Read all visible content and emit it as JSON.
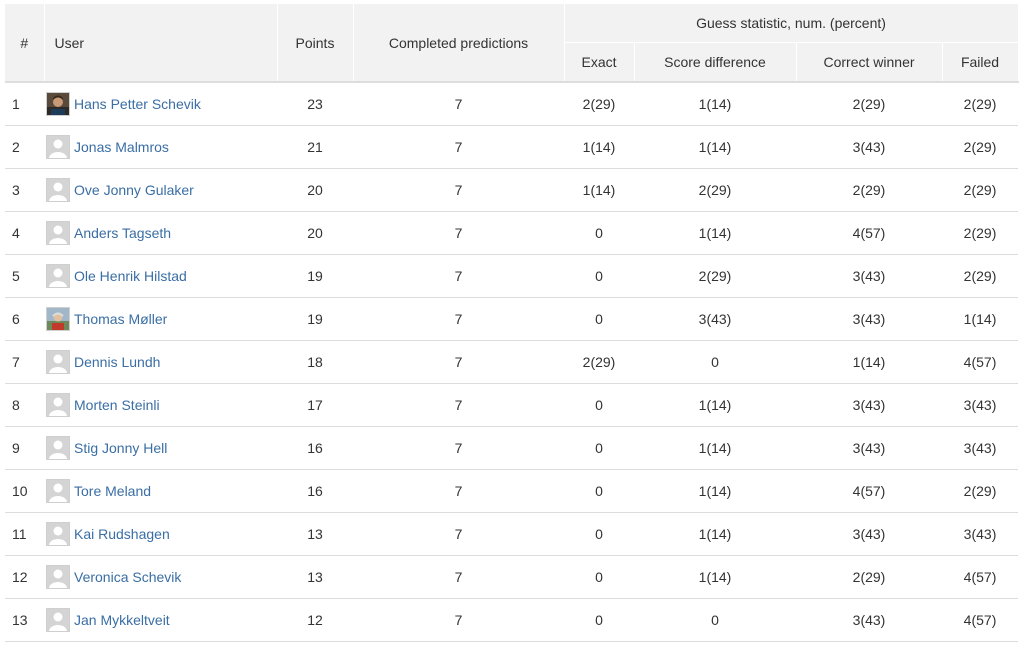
{
  "headers": {
    "rank": "#",
    "user": "User",
    "points": "Points",
    "completed": "Completed predictions",
    "group": "Guess statistic, num. (percent)",
    "exact": "Exact",
    "score_diff": "Score difference",
    "correct_winner": "Correct winner",
    "failed": "Failed"
  },
  "rows": [
    {
      "rank": "1",
      "name": "Hans Petter Schevik",
      "avatar": "photo-avatar-icon",
      "points": "23",
      "completed": "7",
      "exact": "2(29)",
      "score_diff": "1(14)",
      "correct_winner": "2(29)",
      "failed": "2(29)"
    },
    {
      "rank": "2",
      "name": "Jonas Malmros",
      "avatar": "default-avatar-icon",
      "points": "21",
      "completed": "7",
      "exact": "1(14)",
      "score_diff": "1(14)",
      "correct_winner": "3(43)",
      "failed": "2(29)"
    },
    {
      "rank": "3",
      "name": "Ove Jonny Gulaker",
      "avatar": "default-avatar-icon",
      "points": "20",
      "completed": "7",
      "exact": "1(14)",
      "score_diff": "2(29)",
      "correct_winner": "2(29)",
      "failed": "2(29)"
    },
    {
      "rank": "4",
      "name": "Anders Tagseth",
      "avatar": "default-avatar-icon",
      "points": "20",
      "completed": "7",
      "exact": "0",
      "score_diff": "1(14)",
      "correct_winner": "4(57)",
      "failed": "2(29)"
    },
    {
      "rank": "5",
      "name": "Ole Henrik Hilstad",
      "avatar": "default-avatar-icon",
      "points": "19",
      "completed": "7",
      "exact": "0",
      "score_diff": "2(29)",
      "correct_winner": "3(43)",
      "failed": "2(29)"
    },
    {
      "rank": "6",
      "name": "Thomas Møller",
      "avatar": "photo-avatar-icon",
      "points": "19",
      "completed": "7",
      "exact": "0",
      "score_diff": "3(43)",
      "correct_winner": "3(43)",
      "failed": "1(14)"
    },
    {
      "rank": "7",
      "name": "Dennis Lundh",
      "avatar": "default-avatar-icon",
      "points": "18",
      "completed": "7",
      "exact": "2(29)",
      "score_diff": "0",
      "correct_winner": "1(14)",
      "failed": "4(57)"
    },
    {
      "rank": "8",
      "name": "Morten Steinli",
      "avatar": "default-avatar-icon",
      "points": "17",
      "completed": "7",
      "exact": "0",
      "score_diff": "1(14)",
      "correct_winner": "3(43)",
      "failed": "3(43)"
    },
    {
      "rank": "9",
      "name": "Stig Jonny Hell",
      "avatar": "default-avatar-icon",
      "points": "16",
      "completed": "7",
      "exact": "0",
      "score_diff": "1(14)",
      "correct_winner": "3(43)",
      "failed": "3(43)"
    },
    {
      "rank": "10",
      "name": "Tore Meland",
      "avatar": "default-avatar-icon",
      "points": "16",
      "completed": "7",
      "exact": "0",
      "score_diff": "1(14)",
      "correct_winner": "4(57)",
      "failed": "2(29)"
    },
    {
      "rank": "11",
      "name": "Kai Rudshagen",
      "avatar": "default-avatar-icon",
      "points": "13",
      "completed": "7",
      "exact": "0",
      "score_diff": "1(14)",
      "correct_winner": "3(43)",
      "failed": "3(43)"
    },
    {
      "rank": "12",
      "name": "Veronica Schevik",
      "avatar": "default-avatar-icon",
      "points": "13",
      "completed": "7",
      "exact": "0",
      "score_diff": "1(14)",
      "correct_winner": "2(29)",
      "failed": "4(57)"
    },
    {
      "rank": "13",
      "name": "Jan Mykkeltveit",
      "avatar": "default-avatar-icon",
      "points": "12",
      "completed": "7",
      "exact": "0",
      "score_diff": "0",
      "correct_winner": "3(43)",
      "failed": "4(57)"
    }
  ],
  "colors": {
    "link": "#3a6ea5",
    "header_bg": "#f2f2f2",
    "border": "#dddddd"
  }
}
